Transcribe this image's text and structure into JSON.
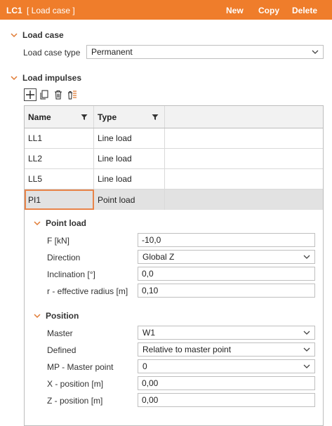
{
  "header": {
    "id": "LC1",
    "subtitle": "[ Load case ]",
    "new_label": "New",
    "copy_label": "Copy",
    "delete_label": "Delete",
    "background": "#ef7d2b"
  },
  "load_case": {
    "title": "Load case",
    "type_label": "Load case type",
    "type_value": "Permanent"
  },
  "load_impulses": {
    "title": "Load impulses",
    "toolbar": [
      "add-icon",
      "copy-icon",
      "delete-icon",
      "delete-all-icon"
    ],
    "columns": [
      "Name",
      "Type"
    ],
    "rows": [
      {
        "name": "LL1",
        "type": "Line load"
      },
      {
        "name": "LL2",
        "type": "Line load"
      },
      {
        "name": "LL5",
        "type": "Line load"
      },
      {
        "name": "PI1",
        "type": "Point load"
      }
    ]
  },
  "point_load": {
    "title": "Point load",
    "f_label": "F [kN]",
    "f_value": "-10,0",
    "direction_label": "Direction",
    "direction_value": "Global Z",
    "inclination_label": "Inclination [°]",
    "inclination_value": "0,0",
    "radius_label": "r - effective radius [m]",
    "radius_value": "0,10"
  },
  "position": {
    "title": "Position",
    "master_label": "Master",
    "master_value": "W1",
    "defined_label": "Defined",
    "defined_value": "Relative to master point",
    "mp_label": "MP - Master point",
    "mp_value": "0",
    "x_label": "X - position [m]",
    "x_value": "0,00",
    "z_label": "Z - position [m]",
    "z_value": "0,00"
  },
  "colors": {
    "accent": "#ef7d2b",
    "selection_outline": "#e8844a"
  }
}
